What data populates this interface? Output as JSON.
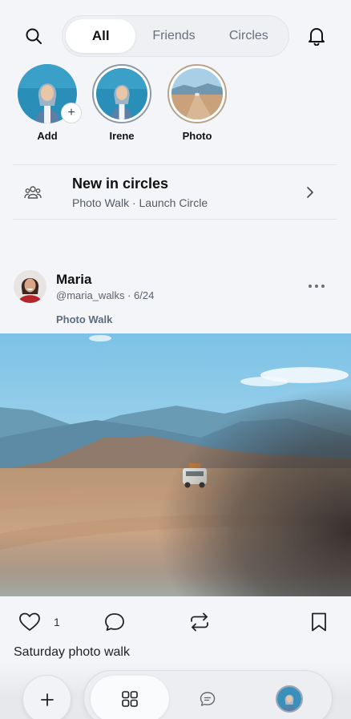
{
  "header": {
    "tabs": [
      {
        "label": "All",
        "active": true
      },
      {
        "label": "Friends",
        "active": false
      },
      {
        "label": "Circles",
        "active": false
      }
    ],
    "search_icon": "search-icon",
    "notifications_icon": "bell-icon"
  },
  "stories": [
    {
      "label": "Add",
      "badge": "+"
    },
    {
      "label": "Irene"
    },
    {
      "label": "Photo"
    }
  ],
  "circles_banner": {
    "title": "New in circles",
    "subtitle": "Photo Walk · Launch Circle",
    "icon": "people-icon"
  },
  "post": {
    "author": "Maria",
    "handle": "@maria_walks · 6/24",
    "circle": "Photo Walk",
    "like_count": "1",
    "caption": "Saturday photo walk"
  },
  "bottom_nav": {
    "compose_icon": "plus-icon",
    "items": [
      "grid-icon",
      "chat-icon",
      "profile-avatar"
    ]
  },
  "colors": {
    "background": "#f4f5f8",
    "text": "#111111",
    "muted": "#5c616a",
    "circle_tag": "#5d6c7c"
  }
}
